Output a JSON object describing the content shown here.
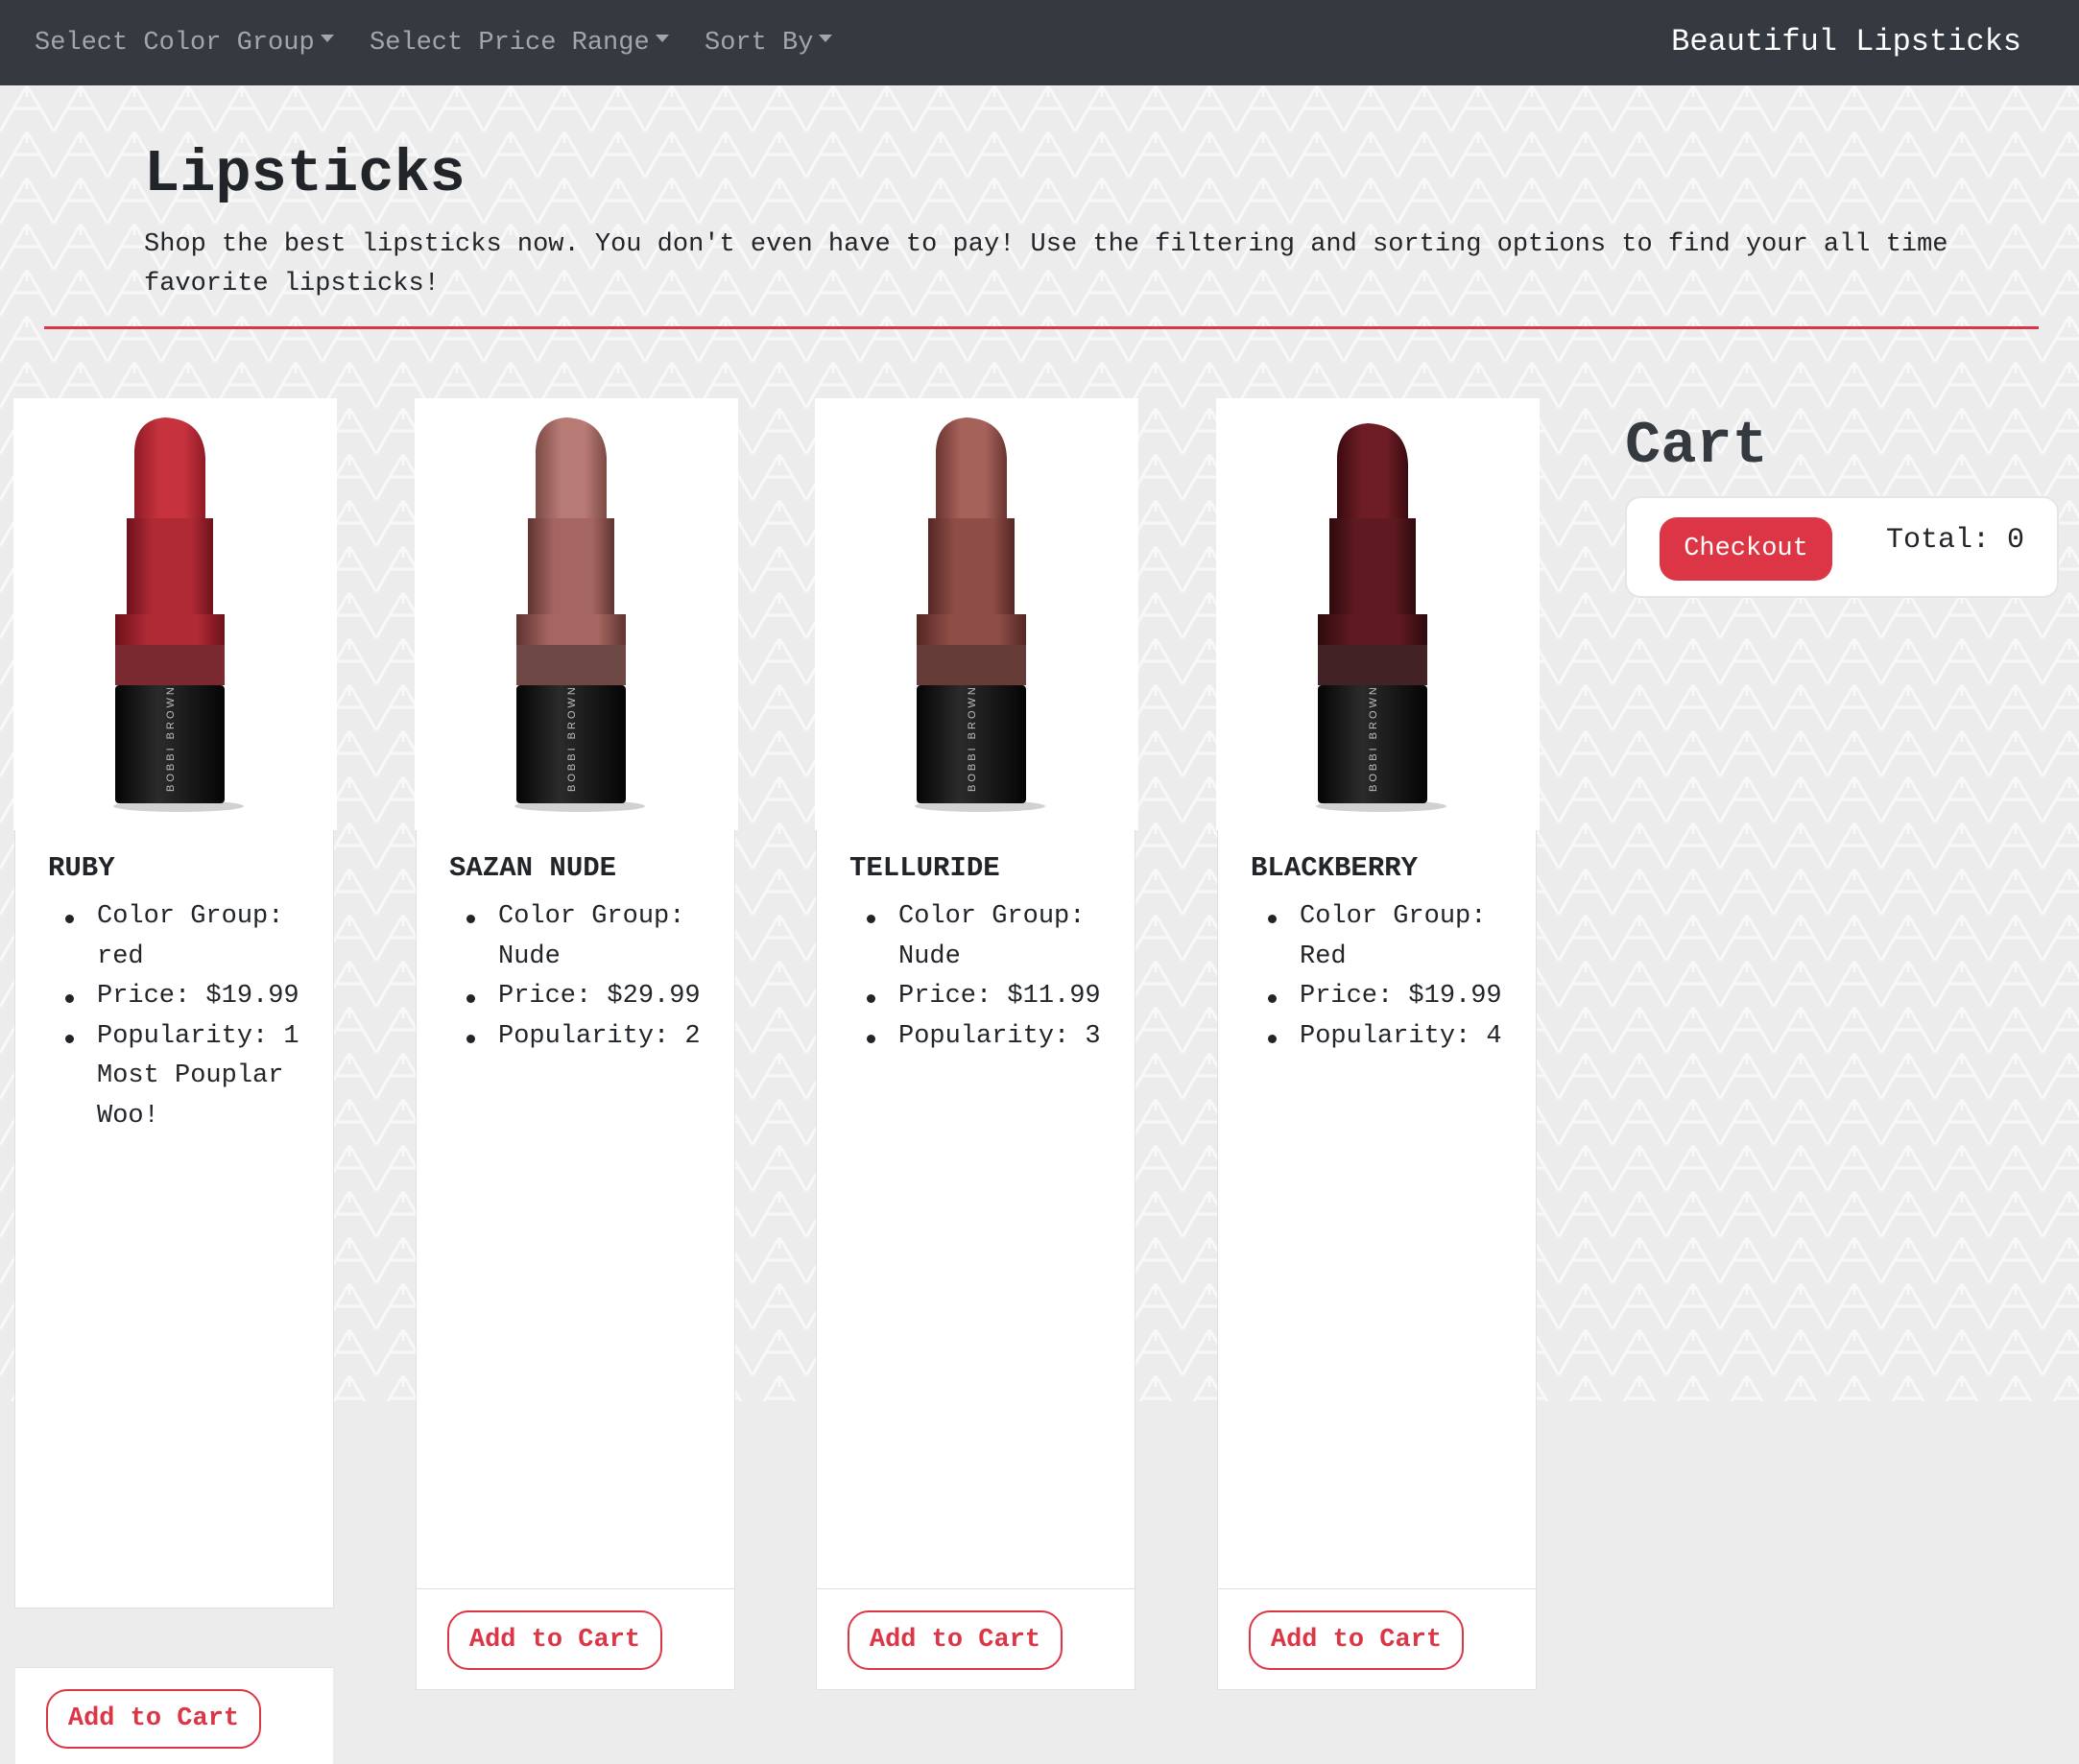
{
  "navbar": {
    "menus": [
      {
        "label": "Select Color Group"
      },
      {
        "label": "Select Price Range"
      },
      {
        "label": "Sort By"
      }
    ],
    "brand": "Beautiful Lipsticks"
  },
  "header": {
    "title": "Lipsticks",
    "intro": "Shop the best lipsticks now. You don't even have to pay! Use the filtering and sorting options to find your all time favorite lipsticks!"
  },
  "products": [
    {
      "name": "RUBY",
      "specs": [
        "Color Group: red",
        "Price: $19.99",
        "Popularity: 1 Most Pouplar Woo!"
      ],
      "button": "Add to Cart",
      "bullet_color": "#c6333f",
      "brand_print": "BOBBI BROWN",
      "colors": {
        "bullet_light": "#c6333f",
        "bullet_dark": "#8e1b25",
        "ferrule_light": "#b02a36",
        "ferrule_dark": "#6d121b"
      }
    },
    {
      "name": "SAZAN NUDE",
      "specs": [
        "Color Group: Nude",
        "Price: $29.99",
        "Popularity: 2"
      ],
      "button": "Add to Cart",
      "brand_print": "BOBBI BROWN",
      "colors": {
        "bullet_light": "#b77a74",
        "bullet_dark": "#7d4a45",
        "ferrule_light": "#a56560",
        "ferrule_dark": "#5e3431"
      }
    },
    {
      "name": "TELLURIDE",
      "specs": [
        "Color Group: Nude",
        "Price: $11.99",
        "Popularity: 3"
      ],
      "button": "Add to Cart",
      "brand_print": "BOBBI BROWN",
      "colors": {
        "bullet_light": "#a5625a",
        "bullet_dark": "#6b3530",
        "ferrule_light": "#8e4d47",
        "ferrule_dark": "#552723"
      }
    },
    {
      "name": "BLACKBERRY",
      "specs": [
        "Color Group: Red",
        "Price: $19.99",
        "Popularity: 4"
      ],
      "button": "Add to Cart",
      "brand_print": "BOBBI BROWN",
      "colors": {
        "bullet_light": "#6e1d26",
        "bullet_dark": "#3a0a10",
        "ferrule_light": "#5e1a20",
        "ferrule_dark": "#2e0a0d"
      }
    }
  ],
  "cart": {
    "title": "Cart",
    "checkout_label": "Checkout",
    "total_label": "Total: 0"
  },
  "theme": {
    "navbar_bg": "#343a40",
    "accent_red": "#dc3545",
    "page_bg": "#ececec"
  }
}
